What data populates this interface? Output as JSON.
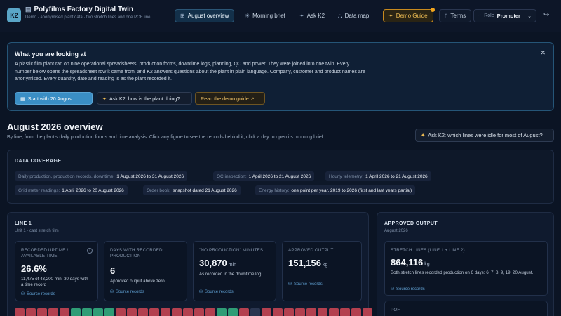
{
  "app": {
    "logo": "K2",
    "title": "Polyfilms Factory Digital Twin",
    "subtitle": "Demo · anonymised plant data · two stretch lines and one POF line"
  },
  "nav": {
    "overview": "August overview",
    "morning_brief": "Morning brief",
    "ask_k2": "Ask K2",
    "data_map": "Data map",
    "demo_guide": "Demo Guide",
    "terms": "Terms",
    "role_label": "Role",
    "role_value": "Promoter"
  },
  "intro": {
    "heading": "What you are looking at",
    "body": "A plastic film plant ran on nine operational spreadsheets: production forms, downtime logs, planning, QC and power. They were joined into one twin. Every number below opens the spreadsheet row it came from, and K2 answers questions about the plant in plain language. Company, customer and product names are anonymised. Every quantity, date and reading is as the plant recorded it.",
    "start_button": "Start with 20 August",
    "ask_button": "Ask K2: how is the plant doing?",
    "guide_button": "Read the demo guide ↗"
  },
  "page": {
    "title": "August 2026 overview",
    "subtitle": "By line, from the plant's daily production forms and time analysis. Click any figure to see the records behind it; click a day to open its morning brief.",
    "ask_idle": "Ask K2: which lines were idle for most of August?"
  },
  "coverage": {
    "heading": "DATA COVERAGE",
    "items": [
      {
        "label": "Daily production, production records, downtime:",
        "value": "1 August 2026 to 31 August 2026"
      },
      {
        "label": "QC inspection:",
        "value": "1 April 2026 to 21 August 2026"
      },
      {
        "label": "Hourly telemetry:",
        "value": "1 April 2026 to 21 August 2026"
      },
      {
        "label": "Grid meter readings:",
        "value": "1 April 2026 to 20 August 2026"
      },
      {
        "label": "Order book:",
        "value": "snapshot dated 21 August 2026"
      },
      {
        "label": "Energy history:",
        "value": "one point per year, 2019 to 2026 (first and last years partial)"
      }
    ]
  },
  "line1": {
    "title": "LINE 1",
    "subtitle": "Unit 1 · cast stretch film",
    "metrics": [
      {
        "label": "Recorded uptime / available time",
        "value": "26.6%",
        "unit": "",
        "desc": "11,475 of 43,200 min, 30 days with a time record",
        "source": "Source records"
      },
      {
        "label": "Days with recorded production",
        "value": "6",
        "unit": "",
        "desc": "Approved output above zero",
        "source": "Source records"
      },
      {
        "label": "\"No production\" minutes",
        "value": "30,870",
        "unit": "min",
        "desc": "As recorded in the downtime log",
        "source": "Source records"
      },
      {
        "label": "Approved output",
        "value": "151,156",
        "unit": "kg",
        "desc": "",
        "source": "Source records"
      }
    ],
    "day_status": [
      "down",
      "down",
      "down",
      "down",
      "down",
      "prod",
      "prod",
      "prod",
      "prod",
      "down",
      "down",
      "down",
      "down",
      "down",
      "down",
      "down",
      "down",
      "down",
      "prod",
      "prod",
      "down",
      "nodata",
      "down",
      "down",
      "down",
      "down",
      "down",
      "down",
      "down",
      "down",
      "down",
      "down"
    ]
  },
  "approved": {
    "title": "APPROVED OUTPUT",
    "subtitle": "August 2026",
    "stretch_label": "STRETCH LINES (LINE 1 + LINE 2)",
    "stretch_value": "864,116",
    "stretch_unit": "kg",
    "stretch_desc": "Both stretch lines recorded production on 6 days: 6, 7, 8, 9, 19, 20 August.",
    "stretch_source": "Source records",
    "pof_label": "POF"
  },
  "colors": {
    "accent": "#3a8ec5",
    "demo": "#f2bf54",
    "day_down": "#b3404f",
    "day_prod": "#2f9d76",
    "day_nodata": "#2a3650"
  }
}
